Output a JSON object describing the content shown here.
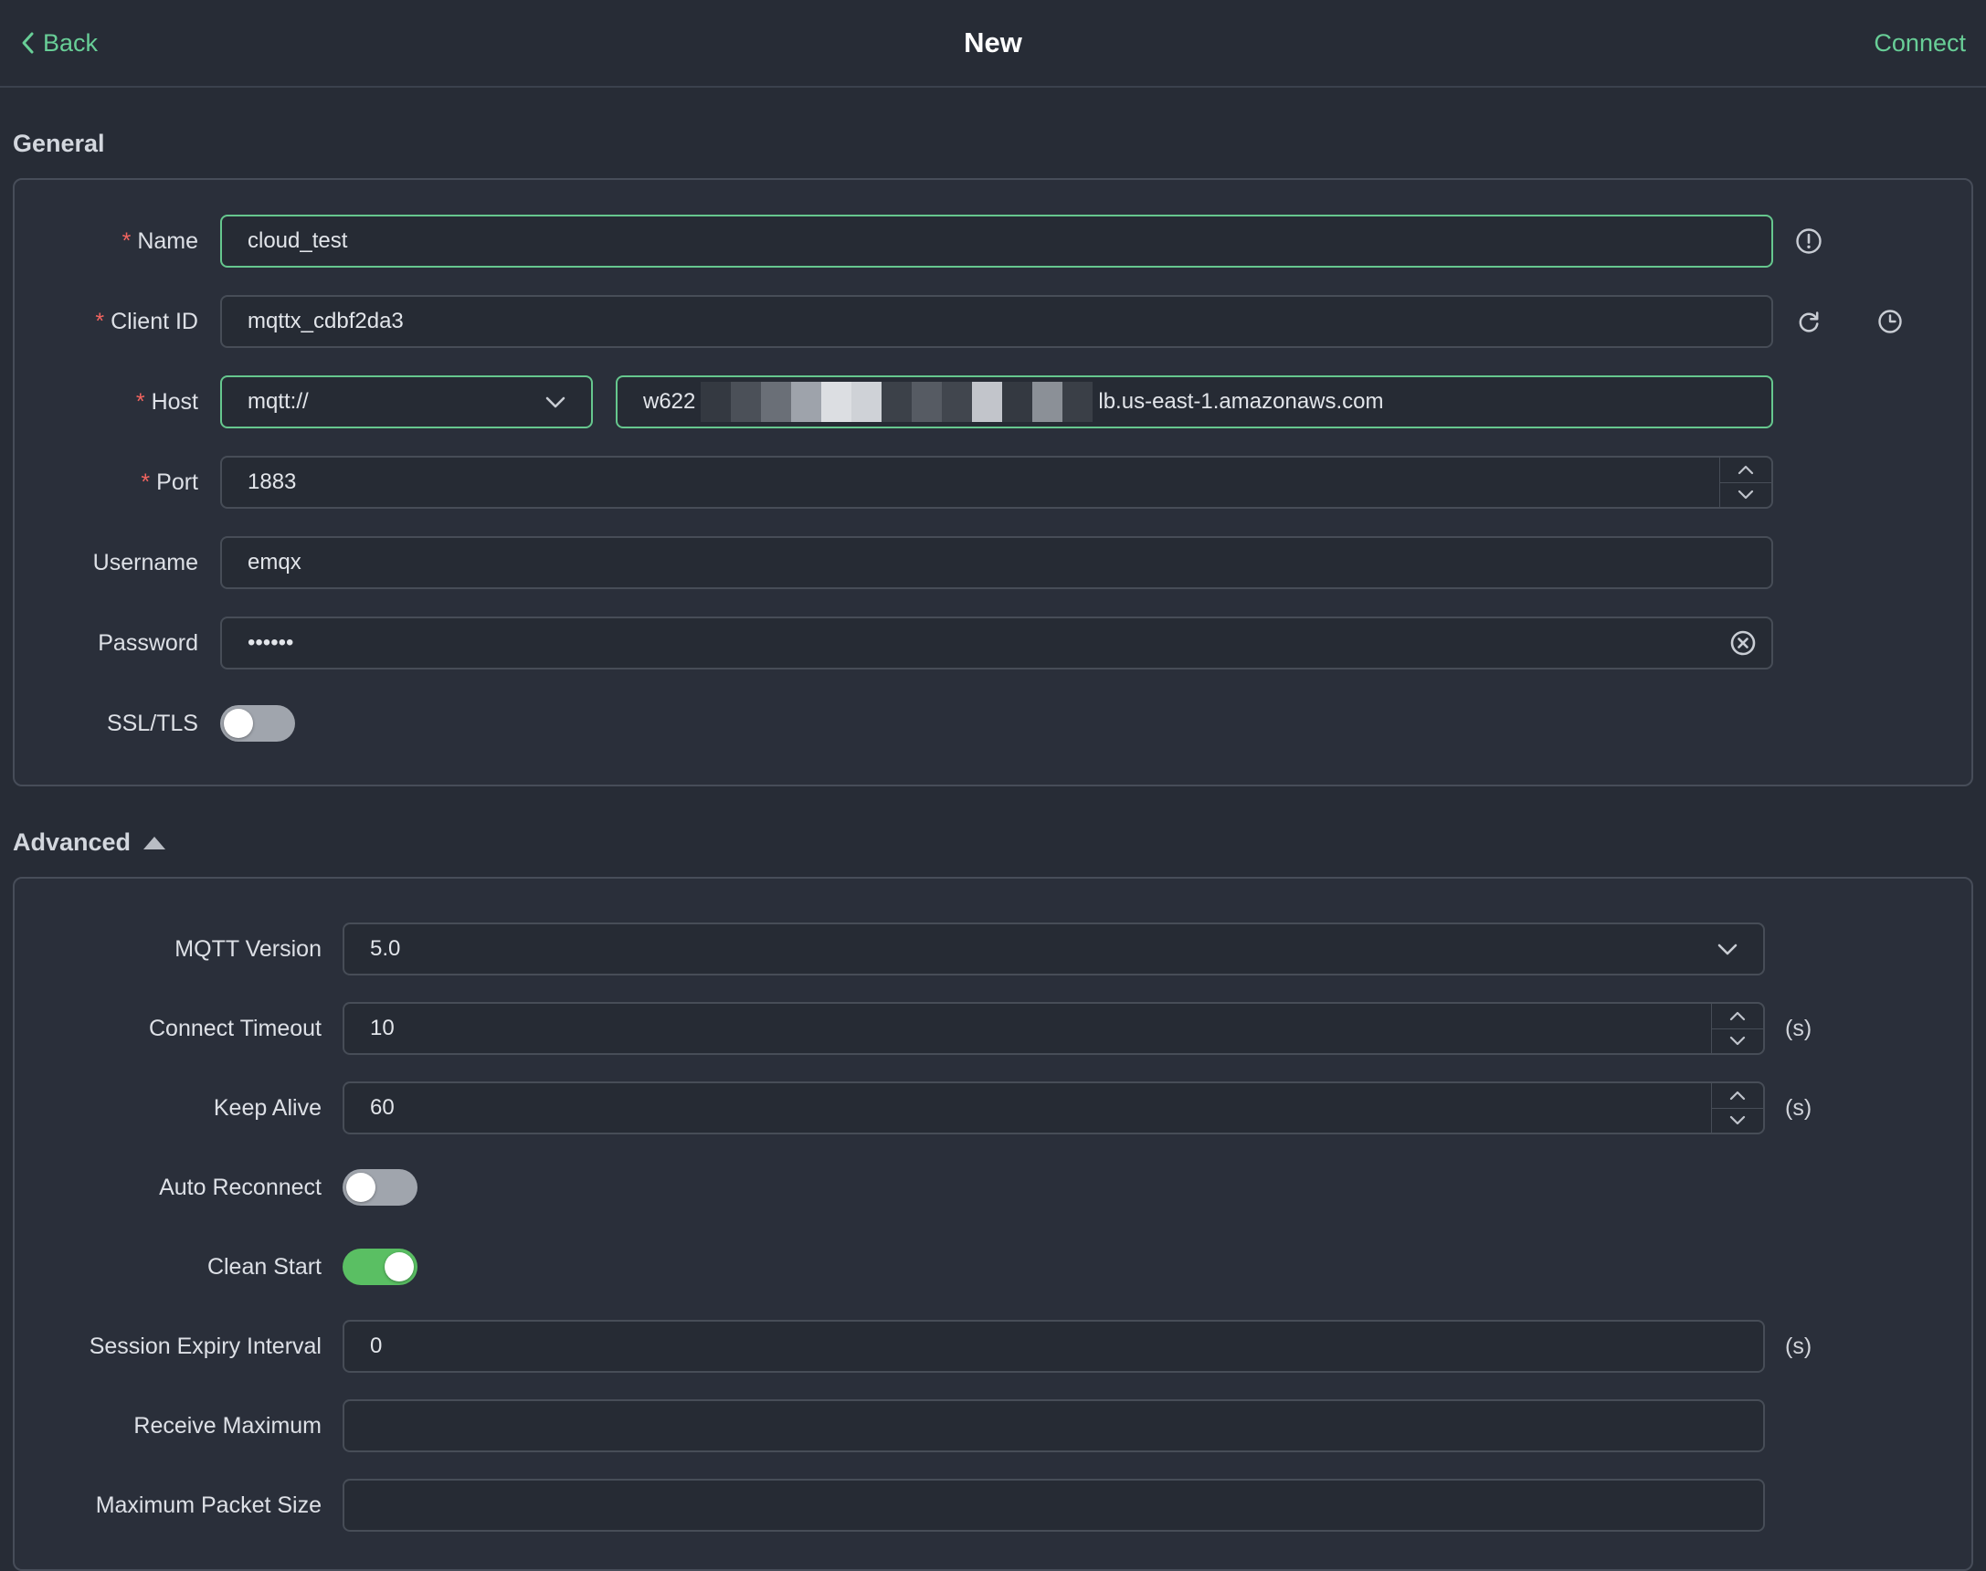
{
  "ui": {
    "required_marker": "*"
  },
  "topbar": {
    "back_label": "Back",
    "title": "New",
    "connect_label": "Connect"
  },
  "sections": {
    "general_title": "General",
    "advanced_title": "Advanced"
  },
  "fields": {
    "name": {
      "label": "Name",
      "required": true,
      "value": "cloud_test"
    },
    "client_id": {
      "label": "Client ID",
      "required": true,
      "value": "mqttx_cdbf2da3"
    },
    "host": {
      "label": "Host",
      "required": true,
      "protocol": "mqtt://",
      "value_prefix": "w622",
      "value_suffix": "lb.us-east-1.amazonaws.com"
    },
    "port": {
      "label": "Port",
      "required": true,
      "value": "1883"
    },
    "username": {
      "label": "Username",
      "value": "emqx"
    },
    "password": {
      "label": "Password",
      "value": "••••••"
    },
    "ssl": {
      "label": "SSL/TLS",
      "enabled": false
    },
    "mqtt_version": {
      "label": "MQTT Version",
      "value": "5.0"
    },
    "connect_timeout": {
      "label": "Connect Timeout",
      "value": "10",
      "unit": "(s)"
    },
    "keep_alive": {
      "label": "Keep Alive",
      "value": "60",
      "unit": "(s)"
    },
    "auto_reconnect": {
      "label": "Auto Reconnect",
      "enabled": false
    },
    "clean_start": {
      "label": "Clean Start",
      "enabled": true
    },
    "session_expiry": {
      "label": "Session Expiry Interval",
      "value": "0",
      "unit": "(s)"
    },
    "receive_maximum": {
      "label": "Receive Maximum",
      "value": ""
    },
    "max_packet_size": {
      "label": "Maximum Packet Size",
      "value": ""
    }
  },
  "colors": {
    "accent_green": "#68ce97",
    "focus_border_green": "#66c78e",
    "toggle_on_green": "#5abf63",
    "required_red": "#f1645f",
    "page_bg": "#272c36",
    "card_bg": "#2a2f3a"
  }
}
